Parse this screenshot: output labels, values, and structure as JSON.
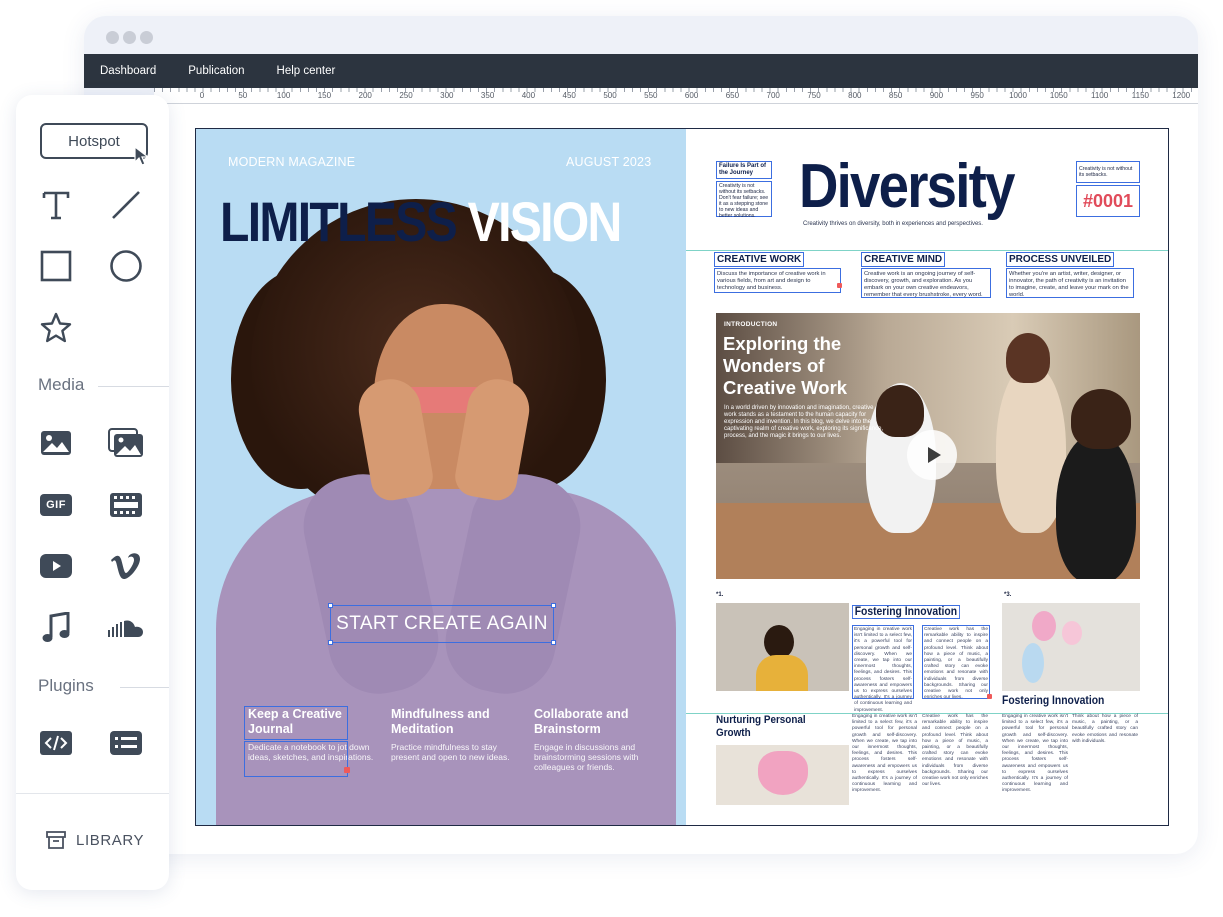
{
  "menubar": {
    "items": [
      "Dashboard",
      "Publication",
      "Help center"
    ]
  },
  "ruler": {
    "ticks": [
      "0",
      "50",
      "100",
      "150",
      "200",
      "250",
      "300",
      "350",
      "400",
      "450",
      "500",
      "550",
      "600",
      "650",
      "700",
      "750",
      "800",
      "850",
      "900",
      "950",
      "1000",
      "1050",
      "1100",
      "1150",
      "1200"
    ]
  },
  "toolbar": {
    "hotspot_label": "Hotspot",
    "media_label": "Media",
    "plugins_label": "Plugins",
    "library_label": "LIBRARY",
    "gif_label": "GIF"
  },
  "cover": {
    "magazine": "MODERN MAGAZINE",
    "date": "AUGUST 2023",
    "title_dark": "LIMITLESS ",
    "title_light": "VISION",
    "cta": "START CREATE AGAIN",
    "features": [
      {
        "title": "Keep a Creative Journal",
        "desc": "Dedicate a notebook to jot down ideas, sketches, and inspirations."
      },
      {
        "title": "Mindfulness and Meditation",
        "desc": "Practice mindfulness to stay present and open to new ideas."
      },
      {
        "title": "Collaborate and Brainstorm",
        "desc": "Engage in discussions and brainstorming sessions with colleagues or friends."
      }
    ]
  },
  "right": {
    "failure_title": "Failure Is Part of the Journey",
    "failure_text": "Creativity is not without its setbacks. Don't fear failure; see it as a stepping stone to new ideas and better solutions.",
    "creativity_note": "Creativity is not without its setbacks.",
    "headline": "Diversity",
    "tagline": "Creativity thrives on diversity, both in experiences and perspectives.",
    "issue": "#0001",
    "sections": [
      {
        "head": "CREATIVE WORK",
        "body": "Discuss the importance of creative work in various fields, from art and design to technology and business."
      },
      {
        "head": "CREATIVE MIND",
        "body": "Creative work is an ongoing journey of self-discovery, growth, and exploration. As you embark on your own creative endeavors, remember that every brushstroke, every word."
      },
      {
        "head": "PROCESS UNVEILED",
        "body": "Whether you're an artist, writer, designer, or innovator, the path of creativity is an invitation to imagine, create, and leave your mark on the world."
      }
    ],
    "intro": {
      "label": "INTRODUCTION",
      "title": "Exploring the Wonders of Creative Work",
      "body": "In a world driven by innovation and imagination, creative work stands as a testament to the human capacity for expression and invention. In this blog, we delve into the captivating realm of creative work, exploring its significance, process, and the magic it brings to our lives."
    },
    "num1": "*1.",
    "num3": "*3.",
    "fostering_1": "Fostering Innovation",
    "fostering_2": "Fostering Innovation",
    "nurturing": "Nurturing Personal Growth",
    "col_a": "Engaging in creative work isn't limited to a select few, it's a powerful tool for personal growth and self-discovery. When we create, we tap into our innermost thoughts, feelings, and desires. This process fosters self-awareness and empowers us to express ourselves authentically. It's a journey of continuous learning and improvement.",
    "col_b": "Creative work has the remarkable ability to inspire and connect people on a profound level. Think about how a piece of music, a painting, or a beautifully crafted story can evoke emotions and resonate with individuals from diverse backgrounds. Sharing our creative work not only enriches our lives.",
    "col_c": "Think about how a piece of music, a painting, or a beautifully crafted story can evoke emotions and resonate with individuals."
  }
}
